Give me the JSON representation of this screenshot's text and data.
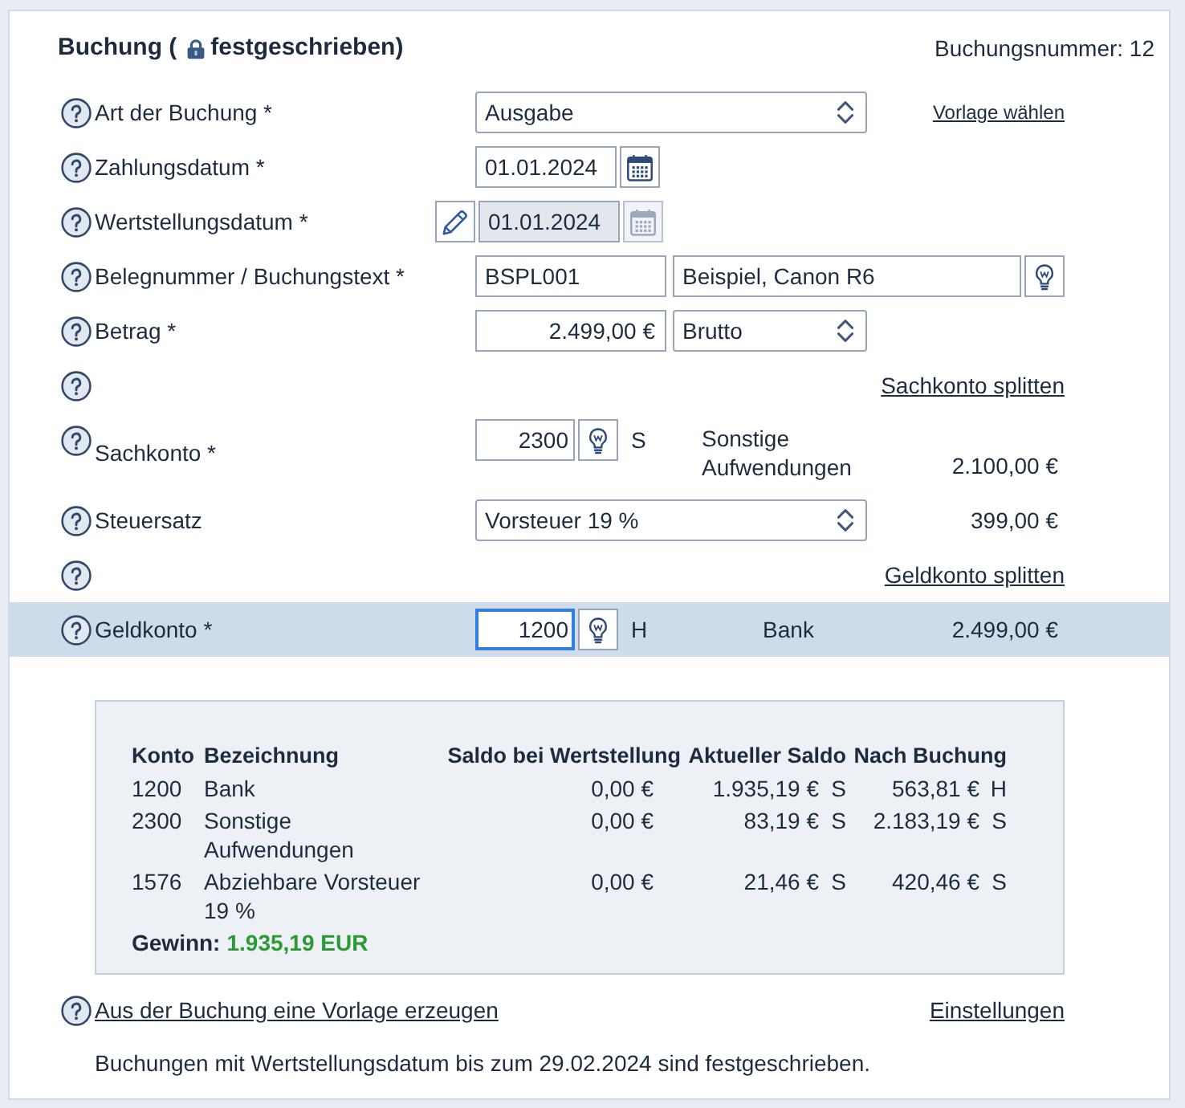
{
  "header": {
    "title": "Buchung (",
    "status": "festgeschrieben)",
    "locked": true,
    "number": "Buchungsnummer: 12"
  },
  "rows": [
    {
      "kind": "select",
      "label": "Art der Buchung *",
      "value": "Ausgabe",
      "link": "Vorlage wählen"
    },
    {
      "kind": "date",
      "label": "Zahlungsdatum *",
      "value": "01.01.2024",
      "disabled": false
    },
    {
      "kind": "date",
      "label": "Wertstellungsdatum *",
      "value": "01.01.2024",
      "disabled": true
    },
    {
      "kind": "text_pair",
      "label": "Belegnummer / Buchungstext *",
      "values": [
        "BSPL001",
        "Beispiel, Canon R6"
      ]
    },
    {
      "kind": "amount",
      "label": "Betrag *",
      "value": "2.499,00 €",
      "mode": "Brutto"
    },
    {
      "kind": "split",
      "link": "Sachkonto splitten"
    },
    {
      "kind": "account",
      "label": "Sachkonto *",
      "value": "2300",
      "side": "S",
      "account_name": "Sonstige Aufwendungen",
      "amount": "2.100,00 €",
      "focused": false
    },
    {
      "kind": "select",
      "label": "Steuersatz",
      "value": "Vorsteuer 19 %",
      "amount": "399,00 €"
    },
    {
      "kind": "split",
      "link": "Geldkonto splitten"
    },
    {
      "kind": "account",
      "label": "Geldkonto *",
      "value": "1200",
      "side": "H",
      "account_name": "Bank",
      "amount": "2.499,00 €",
      "focused": true
    }
  ],
  "summary": {
    "columns": [
      "Konto",
      "Bezeichnung",
      "Saldo bei Wertstellung",
      "Aktueller Saldo",
      "Nach Buchung"
    ],
    "rows": [
      {
        "account": "1200",
        "name": "Bank",
        "balances": [
          {
            "amount": "0,00 €"
          },
          {
            "amount": "1.935,19 €",
            "side": "S"
          },
          {
            "amount": "563,81 €",
            "side": "H"
          }
        ]
      },
      {
        "account": "2300",
        "name": "Sonstige Aufwendungen",
        "balances": [
          {
            "amount": "0,00 €"
          },
          {
            "amount": "83,19 €",
            "side": "S"
          },
          {
            "amount": "2.183,19 €",
            "side": "S"
          }
        ]
      },
      {
        "account": "1576",
        "name": "Abziehbare Vorsteuer 19 %",
        "balances": [
          {
            "amount": "0,00 €"
          },
          {
            "amount": "21,46 €",
            "side": "S"
          },
          {
            "amount": "420,46 €",
            "side": "S"
          }
        ]
      }
    ],
    "result": {
      "label": "Gewinn:",
      "value": "1.935,19 EUR",
      "positive": true
    }
  },
  "footer": {
    "template_link": "Aus der Buchung eine Vorlage erzeugen",
    "settings_link": "Einstellungen",
    "note": "Buchungen mit Wertstellungsdatum bis zum 29.02.2024 sind festgeschrieben."
  }
}
